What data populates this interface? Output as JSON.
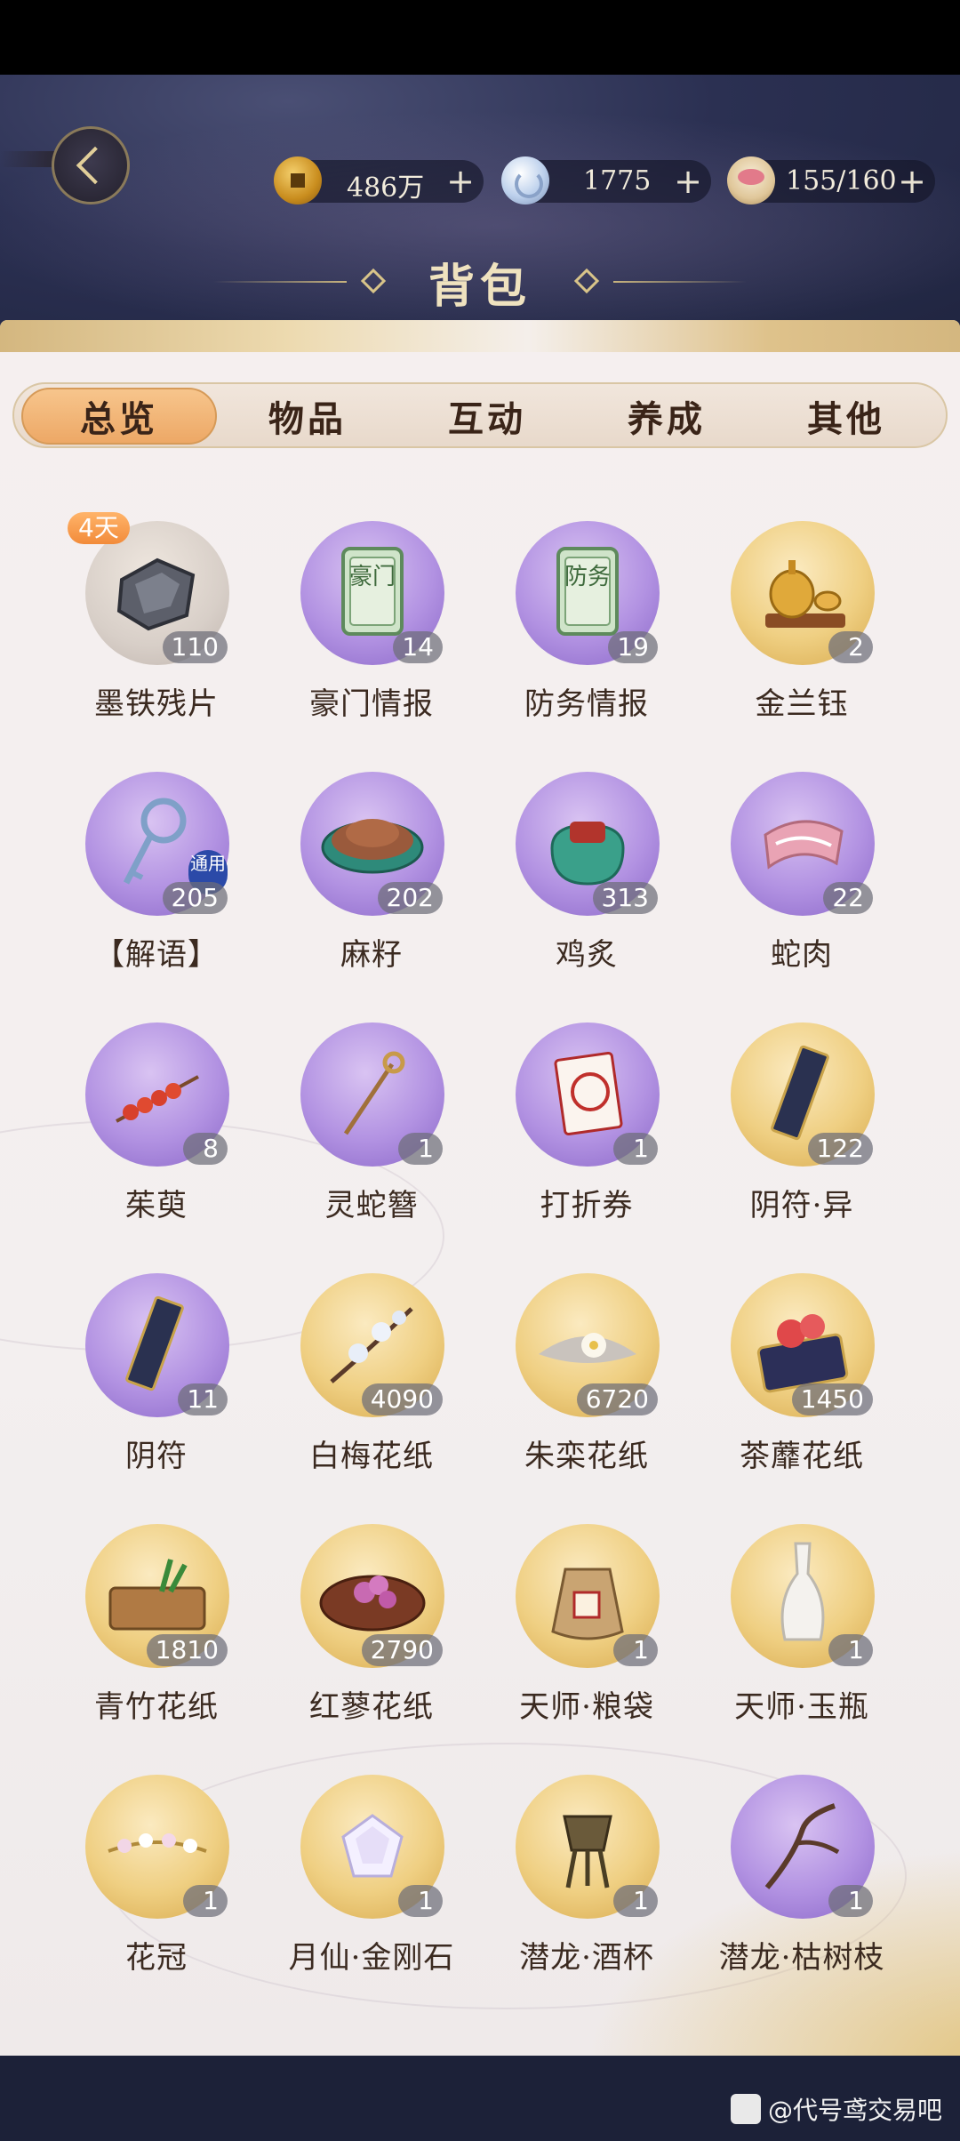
{
  "header": {
    "title": "背包",
    "currencies": [
      {
        "value": "486万",
        "icon": "copper-coin-icon"
      },
      {
        "value": "1775",
        "icon": "jade-orb-icon"
      },
      {
        "value": "155/160",
        "icon": "food-bowl-icon"
      }
    ]
  },
  "tabs": [
    {
      "label": "总览",
      "active": true
    },
    {
      "label": "物品",
      "active": false
    },
    {
      "label": "互动",
      "active": false
    },
    {
      "label": "养成",
      "active": false
    },
    {
      "label": "其他",
      "active": false
    }
  ],
  "items": [
    {
      "name": "墨铁残片",
      "count": "110",
      "bg": "grey",
      "badge": "4天",
      "icon": "iron-shard-icon"
    },
    {
      "name": "豪门情报",
      "count": "14",
      "bg": "purple",
      "icon": "jade-tablet-icon",
      "tablet_text": "豪门"
    },
    {
      "name": "防务情报",
      "count": "19",
      "bg": "purple",
      "icon": "jade-tablet-icon",
      "tablet_text": "防务"
    },
    {
      "name": "金兰钰",
      "count": "2",
      "bg": "gold",
      "icon": "golden-teapot-icon"
    },
    {
      "name": "【解语】",
      "count": "205",
      "bg": "purple",
      "icon": "key-icon",
      "tag": "通用"
    },
    {
      "name": "麻籽",
      "count": "202",
      "bg": "purple",
      "icon": "seed-bowl-icon"
    },
    {
      "name": "鸡炙",
      "count": "313",
      "bg": "purple",
      "icon": "food-bag-icon"
    },
    {
      "name": "蛇肉",
      "count": "22",
      "bg": "purple",
      "icon": "meat-icon"
    },
    {
      "name": "茱萸",
      "count": "8",
      "bg": "purple",
      "icon": "berry-branch-icon"
    },
    {
      "name": "灵蛇簪",
      "count": "1",
      "bg": "purple",
      "icon": "hairpin-icon"
    },
    {
      "name": "打折券",
      "count": "1",
      "bg": "purple",
      "icon": "coupon-icon"
    },
    {
      "name": "阴符·异",
      "count": "122",
      "bg": "gold",
      "icon": "talisman-icon"
    },
    {
      "name": "阴符",
      "count": "11",
      "bg": "purple",
      "icon": "talisman-icon"
    },
    {
      "name": "白梅花纸",
      "count": "4090",
      "bg": "gold",
      "icon": "plum-flower-icon"
    },
    {
      "name": "朱栾花纸",
      "count": "6720",
      "bg": "gold",
      "icon": "white-flower-icon"
    },
    {
      "name": "茶蘼花纸",
      "count": "1450",
      "bg": "gold",
      "icon": "red-flower-icon"
    },
    {
      "name": "青竹花纸",
      "count": "1810",
      "bg": "gold",
      "icon": "bamboo-scroll-icon"
    },
    {
      "name": "红蓼花纸",
      "count": "2790",
      "bg": "gold",
      "icon": "purple-flower-icon"
    },
    {
      "name": "天师·粮袋",
      "count": "1",
      "bg": "gold",
      "icon": "grain-sack-icon"
    },
    {
      "name": "天师·玉瓶",
      "count": "1",
      "bg": "gold",
      "icon": "vase-icon"
    },
    {
      "name": "花冠",
      "count": "1",
      "bg": "gold",
      "icon": "flower-crown-icon"
    },
    {
      "name": "月仙·金刚石",
      "count": "1",
      "bg": "gold",
      "icon": "diamond-icon"
    },
    {
      "name": "潜龙·酒杯",
      "count": "1",
      "bg": "gold",
      "icon": "bronze-cup-icon"
    },
    {
      "name": "潜龙·枯树枝",
      "count": "1",
      "bg": "purple",
      "icon": "dry-branch-icon"
    }
  ],
  "watermark": "@代号鸢交易吧"
}
